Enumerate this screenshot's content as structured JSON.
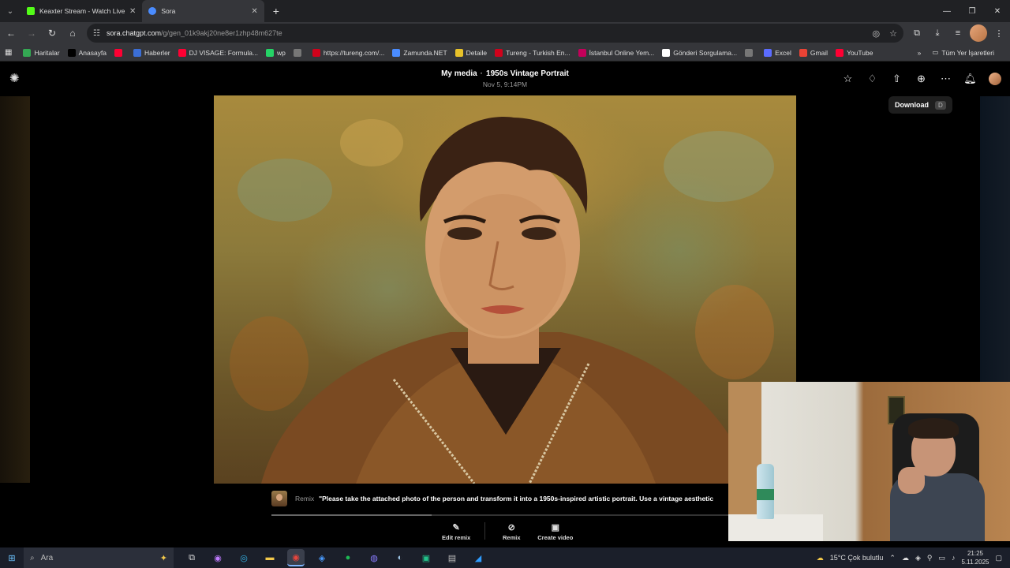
{
  "browser": {
    "tabs": [
      {
        "title": "Keaxter Stream - Watch Live on",
        "color": "#53fc18",
        "active": false
      },
      {
        "title": "Sora",
        "color": "#4a8cff",
        "active": true
      }
    ],
    "url_host": "sora.chatgpt.com",
    "url_path": "/g/gen_01k9akj20ne8er1zhp48m627te",
    "bookmarks": [
      {
        "label": "Haritalar",
        "icon": "maps-pin-icon",
        "color": "#34a853"
      },
      {
        "label": "Anasayfa",
        "icon": "x-icon",
        "color": "#000000"
      },
      {
        "label": "",
        "icon": "youtube-icon",
        "color": "#ff0033"
      },
      {
        "label": "Haberler",
        "icon": "news-icon",
        "color": "#3b6ed6"
      },
      {
        "label": "DJ VISAGE: Formula...",
        "icon": "youtube-icon",
        "color": "#ff0033"
      },
      {
        "label": "wp",
        "icon": "whatsapp-icon",
        "color": "#25d366"
      },
      {
        "label": "",
        "icon": "globe-icon",
        "color": "#777777"
      },
      {
        "label": "https://tureng.com/...",
        "icon": "tureng-icon",
        "color": "#d0021b"
      },
      {
        "label": "Zamunda.NET",
        "icon": "globe-icon",
        "color": "#4a8cff"
      },
      {
        "label": "Detaile",
        "icon": "folder-icon",
        "color": "#e8c22a"
      },
      {
        "label": "Tureng - Turkish En...",
        "icon": "tureng-icon",
        "color": "#d0021b"
      },
      {
        "label": "İstanbul Online Yem...",
        "icon": "y-icon",
        "color": "#c4005a"
      },
      {
        "label": "Gönderi Sorgulama...",
        "icon": "envelope-icon",
        "color": "#ffffff"
      },
      {
        "label": "",
        "icon": "globe-icon",
        "color": "#777777"
      },
      {
        "label": "Excel",
        "icon": "copilot-icon",
        "color": "#5b6cff"
      },
      {
        "label": "Gmail",
        "icon": "gmail-icon",
        "color": "#ea4335"
      },
      {
        "label": "YouTube",
        "icon": "youtube-icon",
        "color": "#ff0033"
      }
    ],
    "all_bookmarks": "Tüm Yer İşaretleri"
  },
  "app": {
    "breadcrumb_parent": "My media",
    "title": "1950s Vintage Portrait",
    "date": "Nov 5, 9:14PM",
    "tooltip_label": "Download",
    "tooltip_key": "D",
    "remix_label": "Remix",
    "remix_prompt": "\"Please take the attached photo of the person and transform it into a 1950s-inspired artistic portrait. Use a vintage aesthetic",
    "progress_fraction": 0.35,
    "actions": [
      {
        "label": "Edit remix",
        "icon": "pencil-icon"
      },
      {
        "label": "Remix",
        "icon": "remix-icon"
      },
      {
        "label": "Create video",
        "icon": "video-icon"
      }
    ]
  },
  "taskbar": {
    "search_placeholder": "Ara",
    "weather": "15°C  Çok bulutlu",
    "time": "21:25",
    "date": "5.11.2025"
  }
}
